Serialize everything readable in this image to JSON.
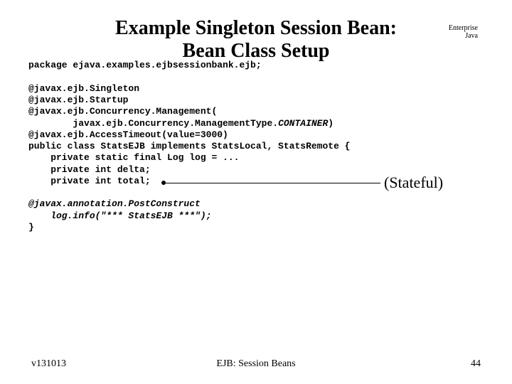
{
  "title_line1": "Example Singleton Session Bean:",
  "title_line2": "Bean Class Setup",
  "corner_line1": "Enterprise",
  "corner_line2": "Java",
  "code": {
    "l01": "package ejava.examples.ejbsessionbank.ejb;",
    "l02": "",
    "l03": "@javax.ejb.Singleton",
    "l04": "@javax.ejb.Startup",
    "l05": "@javax.ejb.Concurrency.Management(",
    "l06": "        javax.ejb.Concurrency.ManagementType.",
    "l06b": "CONTAINER",
    "l06c": ")",
    "l07": "@javax.ejb.AccessTimeout(value=3000)",
    "l08": "public class StatsEJB implements StatsLocal, StatsRemote {",
    "l09": "    private static final Log log = ...",
    "l10": "    private int delta;",
    "l11": "    private int total;",
    "l12": "",
    "l13": "@javax.annotation.PostConstruct",
    "l14": "    log.info(\"*** StatsEJB ***\");",
    "l15": "}"
  },
  "annotation": "(Stateful)",
  "footer": {
    "left": "v131013",
    "center": "EJB: Session Beans",
    "right": "44"
  }
}
